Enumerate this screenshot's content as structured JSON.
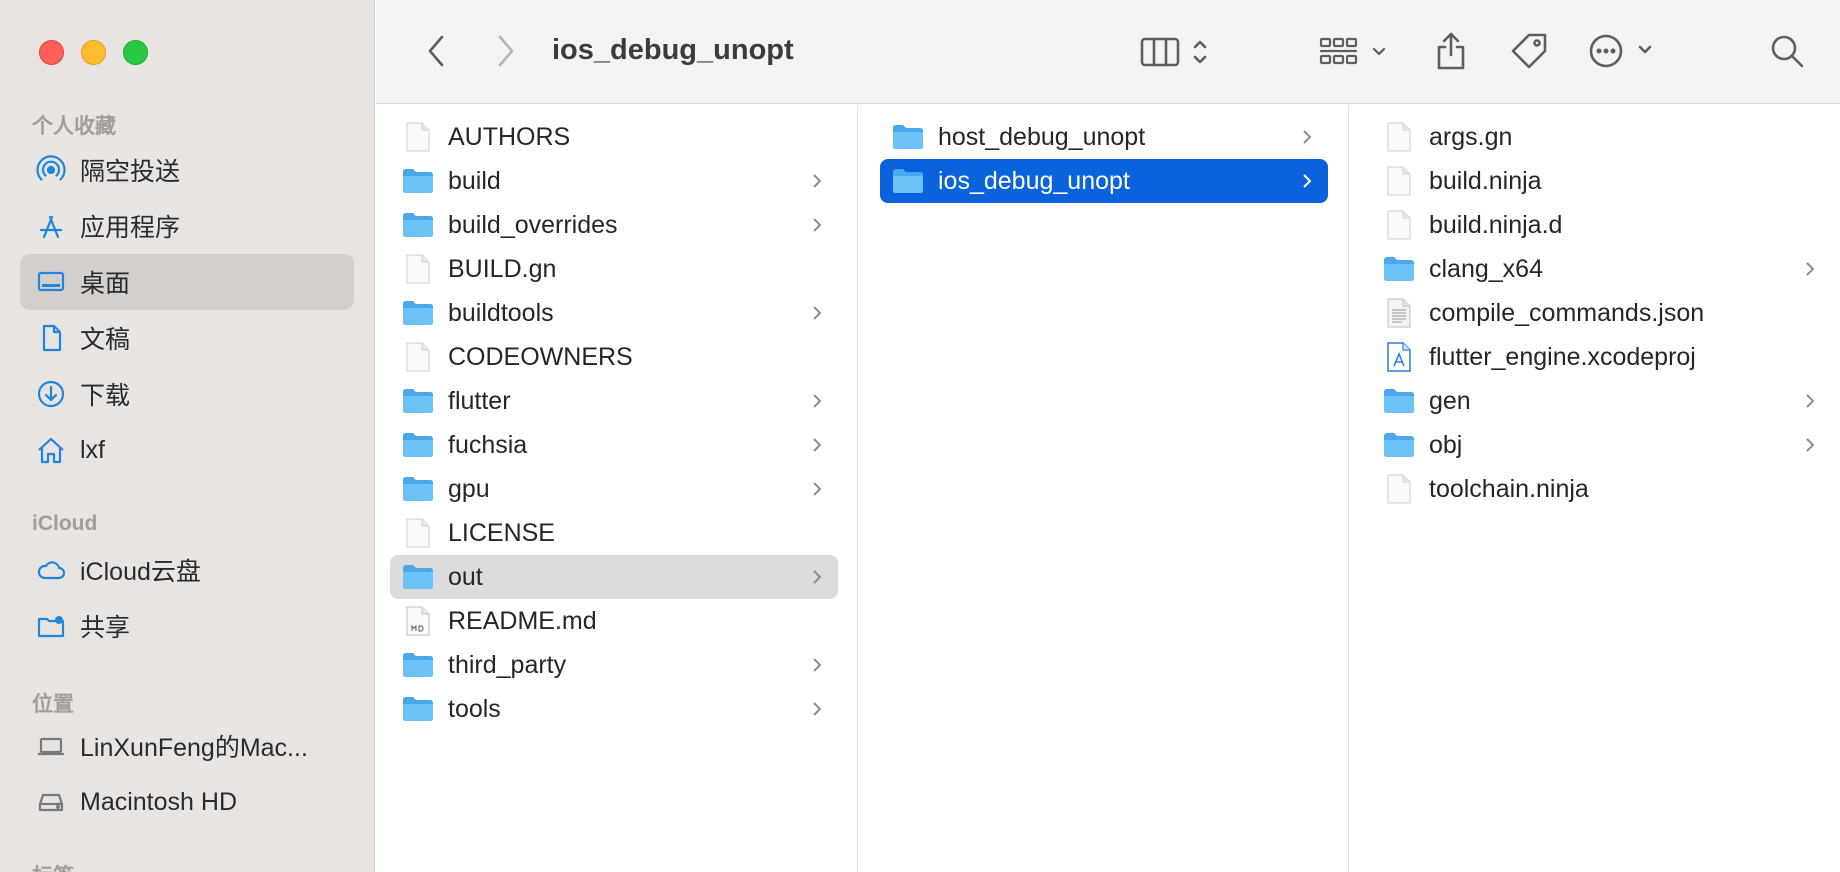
{
  "window": {
    "title": "ios_debug_unopt"
  },
  "sidebar": {
    "sections": [
      {
        "label": "个人收藏"
      },
      {
        "label": "iCloud"
      },
      {
        "label": "位置"
      },
      {
        "label": "标签"
      }
    ],
    "favorites": [
      {
        "label": "隔空投送",
        "icon": "airdrop-icon"
      },
      {
        "label": "应用程序",
        "icon": "applications-icon"
      },
      {
        "label": "桌面",
        "icon": "desktop-icon",
        "selected": true
      },
      {
        "label": "文稿",
        "icon": "document-icon"
      },
      {
        "label": "下载",
        "icon": "download-icon"
      },
      {
        "label": "lxf",
        "icon": "home-icon"
      }
    ],
    "icloud": [
      {
        "label": "iCloud云盘",
        "icon": "icloud-icon"
      },
      {
        "label": "共享",
        "icon": "shared-folder-icon"
      }
    ],
    "locations": [
      {
        "label": "LinXunFeng的Mac...",
        "icon": "laptop-icon"
      },
      {
        "label": "Macintosh HD",
        "icon": "hard-drive-icon"
      }
    ]
  },
  "columns": {
    "col1": [
      {
        "name": "AUTHORS",
        "type": "file"
      },
      {
        "name": "build",
        "type": "folder"
      },
      {
        "name": "build_overrides",
        "type": "folder"
      },
      {
        "name": "BUILD.gn",
        "type": "file"
      },
      {
        "name": "buildtools",
        "type": "folder"
      },
      {
        "name": "CODEOWNERS",
        "type": "file"
      },
      {
        "name": "flutter",
        "type": "folder"
      },
      {
        "name": "fuchsia",
        "type": "folder"
      },
      {
        "name": "gpu",
        "type": "folder"
      },
      {
        "name": "LICENSE",
        "type": "file"
      },
      {
        "name": "out",
        "type": "folder",
        "selected": "gray"
      },
      {
        "name": "README.md",
        "type": "md"
      },
      {
        "name": "third_party",
        "type": "folder"
      },
      {
        "name": "tools",
        "type": "folder"
      }
    ],
    "col2": [
      {
        "name": "host_debug_unopt",
        "type": "folder"
      },
      {
        "name": "ios_debug_unopt",
        "type": "folder",
        "selected": "blue"
      }
    ],
    "col3": [
      {
        "name": "args.gn",
        "type": "file"
      },
      {
        "name": "build.ninja",
        "type": "file"
      },
      {
        "name": "build.ninja.d",
        "type": "file"
      },
      {
        "name": "clang_x64",
        "type": "folder"
      },
      {
        "name": "compile_commands.json",
        "type": "json"
      },
      {
        "name": "flutter_engine.xcodeproj",
        "type": "xcodeproj"
      },
      {
        "name": "gen",
        "type": "folder"
      },
      {
        "name": "obj",
        "type": "folder"
      },
      {
        "name": "toolchain.ninja",
        "type": "file"
      }
    ]
  },
  "colors": {
    "selection_blue": "#0a63dd",
    "folder_blue": "#5bb5f0",
    "sidebar_accent": "#1f86e0"
  }
}
